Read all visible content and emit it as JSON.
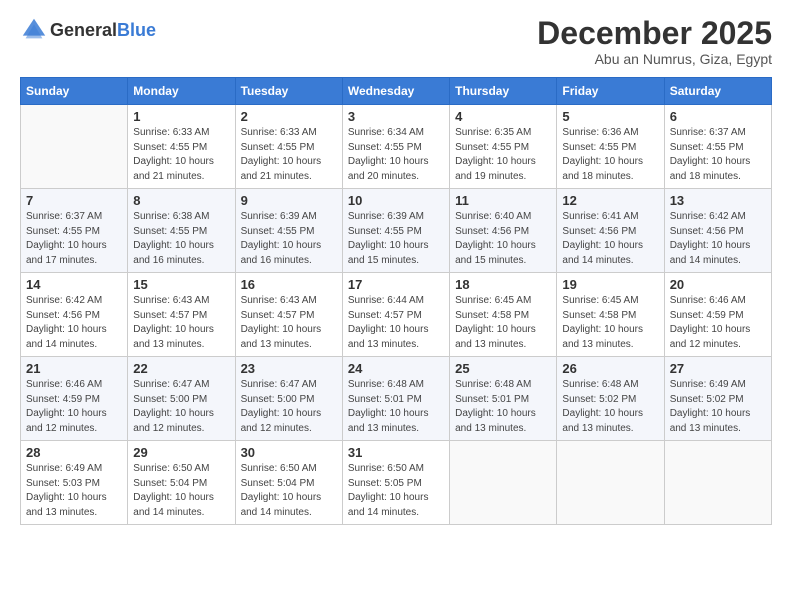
{
  "logo": {
    "general": "General",
    "blue": "Blue"
  },
  "title": "December 2025",
  "subtitle": "Abu an Numrus, Giza, Egypt",
  "headers": [
    "Sunday",
    "Monday",
    "Tuesday",
    "Wednesday",
    "Thursday",
    "Friday",
    "Saturday"
  ],
  "weeks": [
    [
      {
        "day": "",
        "info": ""
      },
      {
        "day": "1",
        "info": "Sunrise: 6:33 AM\nSunset: 4:55 PM\nDaylight: 10 hours\nand 21 minutes."
      },
      {
        "day": "2",
        "info": "Sunrise: 6:33 AM\nSunset: 4:55 PM\nDaylight: 10 hours\nand 21 minutes."
      },
      {
        "day": "3",
        "info": "Sunrise: 6:34 AM\nSunset: 4:55 PM\nDaylight: 10 hours\nand 20 minutes."
      },
      {
        "day": "4",
        "info": "Sunrise: 6:35 AM\nSunset: 4:55 PM\nDaylight: 10 hours\nand 19 minutes."
      },
      {
        "day": "5",
        "info": "Sunrise: 6:36 AM\nSunset: 4:55 PM\nDaylight: 10 hours\nand 18 minutes."
      },
      {
        "day": "6",
        "info": "Sunrise: 6:37 AM\nSunset: 4:55 PM\nDaylight: 10 hours\nand 18 minutes."
      }
    ],
    [
      {
        "day": "7",
        "info": "Sunrise: 6:37 AM\nSunset: 4:55 PM\nDaylight: 10 hours\nand 17 minutes."
      },
      {
        "day": "8",
        "info": "Sunrise: 6:38 AM\nSunset: 4:55 PM\nDaylight: 10 hours\nand 16 minutes."
      },
      {
        "day": "9",
        "info": "Sunrise: 6:39 AM\nSunset: 4:55 PM\nDaylight: 10 hours\nand 16 minutes."
      },
      {
        "day": "10",
        "info": "Sunrise: 6:39 AM\nSunset: 4:55 PM\nDaylight: 10 hours\nand 15 minutes."
      },
      {
        "day": "11",
        "info": "Sunrise: 6:40 AM\nSunset: 4:56 PM\nDaylight: 10 hours\nand 15 minutes."
      },
      {
        "day": "12",
        "info": "Sunrise: 6:41 AM\nSunset: 4:56 PM\nDaylight: 10 hours\nand 14 minutes."
      },
      {
        "day": "13",
        "info": "Sunrise: 6:42 AM\nSunset: 4:56 PM\nDaylight: 10 hours\nand 14 minutes."
      }
    ],
    [
      {
        "day": "14",
        "info": "Sunrise: 6:42 AM\nSunset: 4:56 PM\nDaylight: 10 hours\nand 14 minutes."
      },
      {
        "day": "15",
        "info": "Sunrise: 6:43 AM\nSunset: 4:57 PM\nDaylight: 10 hours\nand 13 minutes."
      },
      {
        "day": "16",
        "info": "Sunrise: 6:43 AM\nSunset: 4:57 PM\nDaylight: 10 hours\nand 13 minutes."
      },
      {
        "day": "17",
        "info": "Sunrise: 6:44 AM\nSunset: 4:57 PM\nDaylight: 10 hours\nand 13 minutes."
      },
      {
        "day": "18",
        "info": "Sunrise: 6:45 AM\nSunset: 4:58 PM\nDaylight: 10 hours\nand 13 minutes."
      },
      {
        "day": "19",
        "info": "Sunrise: 6:45 AM\nSunset: 4:58 PM\nDaylight: 10 hours\nand 13 minutes."
      },
      {
        "day": "20",
        "info": "Sunrise: 6:46 AM\nSunset: 4:59 PM\nDaylight: 10 hours\nand 12 minutes."
      }
    ],
    [
      {
        "day": "21",
        "info": "Sunrise: 6:46 AM\nSunset: 4:59 PM\nDaylight: 10 hours\nand 12 minutes."
      },
      {
        "day": "22",
        "info": "Sunrise: 6:47 AM\nSunset: 5:00 PM\nDaylight: 10 hours\nand 12 minutes."
      },
      {
        "day": "23",
        "info": "Sunrise: 6:47 AM\nSunset: 5:00 PM\nDaylight: 10 hours\nand 12 minutes."
      },
      {
        "day": "24",
        "info": "Sunrise: 6:48 AM\nSunset: 5:01 PM\nDaylight: 10 hours\nand 13 minutes."
      },
      {
        "day": "25",
        "info": "Sunrise: 6:48 AM\nSunset: 5:01 PM\nDaylight: 10 hours\nand 13 minutes."
      },
      {
        "day": "26",
        "info": "Sunrise: 6:48 AM\nSunset: 5:02 PM\nDaylight: 10 hours\nand 13 minutes."
      },
      {
        "day": "27",
        "info": "Sunrise: 6:49 AM\nSunset: 5:02 PM\nDaylight: 10 hours\nand 13 minutes."
      }
    ],
    [
      {
        "day": "28",
        "info": "Sunrise: 6:49 AM\nSunset: 5:03 PM\nDaylight: 10 hours\nand 13 minutes."
      },
      {
        "day": "29",
        "info": "Sunrise: 6:50 AM\nSunset: 5:04 PM\nDaylight: 10 hours\nand 14 minutes."
      },
      {
        "day": "30",
        "info": "Sunrise: 6:50 AM\nSunset: 5:04 PM\nDaylight: 10 hours\nand 14 minutes."
      },
      {
        "day": "31",
        "info": "Sunrise: 6:50 AM\nSunset: 5:05 PM\nDaylight: 10 hours\nand 14 minutes."
      },
      {
        "day": "",
        "info": ""
      },
      {
        "day": "",
        "info": ""
      },
      {
        "day": "",
        "info": ""
      }
    ]
  ]
}
